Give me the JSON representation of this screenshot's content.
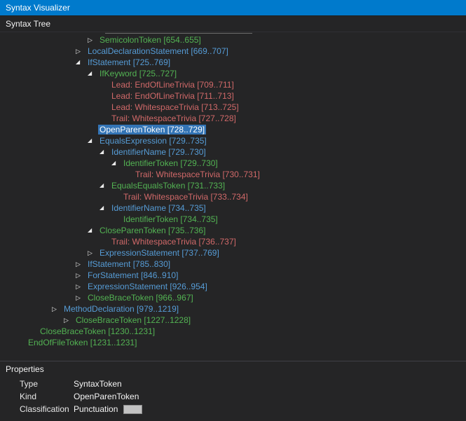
{
  "window": {
    "title": "Syntax Visualizer"
  },
  "panel": {
    "header": "Syntax Tree"
  },
  "colors": {
    "titlebar": "#007ACC",
    "node": "#569CD6",
    "token": "#53B353",
    "trivia": "#D16969",
    "selection_bg": "#3374B5"
  },
  "icons": {
    "expander_collapsed": "▷",
    "expander_expanded": "◢"
  },
  "tree": {
    "rows": [
      {
        "label": "SemicolonToken",
        "range": "[654..655]",
        "kind": "token",
        "level": 7,
        "expander": "collapsed",
        "selected": false
      },
      {
        "label": "LocalDeclarationStatement",
        "range": "[669..707]",
        "kind": "node",
        "level": 6,
        "expander": "collapsed",
        "selected": false
      },
      {
        "label": "IfStatement",
        "range": "[725..769]",
        "kind": "node",
        "level": 6,
        "expander": "expanded",
        "selected": false
      },
      {
        "label": "IfKeyword",
        "range": "[725..727]",
        "kind": "token",
        "level": 7,
        "expander": "expanded",
        "selected": false
      },
      {
        "label": "Lead: EndOfLineTrivia",
        "range": "[709..711]",
        "kind": "trivia",
        "level": 8,
        "expander": "none",
        "selected": false
      },
      {
        "label": "Lead: EndOfLineTrivia",
        "range": "[711..713]",
        "kind": "trivia",
        "level": 8,
        "expander": "none",
        "selected": false
      },
      {
        "label": "Lead: WhitespaceTrivia",
        "range": "[713..725]",
        "kind": "trivia",
        "level": 8,
        "expander": "none",
        "selected": false
      },
      {
        "label": "Trail: WhitespaceTrivia",
        "range": "[727..728]",
        "kind": "trivia",
        "level": 8,
        "expander": "none",
        "selected": false
      },
      {
        "label": "OpenParenToken",
        "range": "[728..729]",
        "kind": "token",
        "level": 7,
        "expander": "none",
        "selected": true
      },
      {
        "label": "EqualsExpression",
        "range": "[729..735]",
        "kind": "node",
        "level": 7,
        "expander": "expanded",
        "selected": false
      },
      {
        "label": "IdentifierName",
        "range": "[729..730]",
        "kind": "node",
        "level": 8,
        "expander": "expanded",
        "selected": false
      },
      {
        "label": "IdentifierToken",
        "range": "[729..730]",
        "kind": "token",
        "level": 9,
        "expander": "expanded",
        "selected": false
      },
      {
        "label": "Trail: WhitespaceTrivia",
        "range": "[730..731]",
        "kind": "trivia",
        "level": 10,
        "expander": "none",
        "selected": false
      },
      {
        "label": "EqualsEqualsToken",
        "range": "[731..733]",
        "kind": "token",
        "level": 8,
        "expander": "expanded",
        "selected": false
      },
      {
        "label": "Trail: WhitespaceTrivia",
        "range": "[733..734]",
        "kind": "trivia",
        "level": 9,
        "expander": "none",
        "selected": false
      },
      {
        "label": "IdentifierName",
        "range": "[734..735]",
        "kind": "node",
        "level": 8,
        "expander": "expanded",
        "selected": false
      },
      {
        "label": "IdentifierToken",
        "range": "[734..735]",
        "kind": "token",
        "level": 9,
        "expander": "none",
        "selected": false
      },
      {
        "label": "CloseParenToken",
        "range": "[735..736]",
        "kind": "token",
        "level": 7,
        "expander": "expanded",
        "selected": false
      },
      {
        "label": "Trail: WhitespaceTrivia",
        "range": "[736..737]",
        "kind": "trivia",
        "level": 8,
        "expander": "none",
        "selected": false
      },
      {
        "label": "ExpressionStatement",
        "range": "[737..769]",
        "kind": "node",
        "level": 7,
        "expander": "collapsed",
        "selected": false
      },
      {
        "label": "IfStatement",
        "range": "[785..830]",
        "kind": "node",
        "level": 6,
        "expander": "collapsed",
        "selected": false
      },
      {
        "label": "ForStatement",
        "range": "[846..910]",
        "kind": "node",
        "level": 6,
        "expander": "collapsed",
        "selected": false
      },
      {
        "label": "ExpressionStatement",
        "range": "[926..954]",
        "kind": "node",
        "level": 6,
        "expander": "collapsed",
        "selected": false
      },
      {
        "label": "CloseBraceToken",
        "range": "[966..967]",
        "kind": "token",
        "level": 6,
        "expander": "collapsed",
        "selected": false
      },
      {
        "label": "MethodDeclaration",
        "range": "[979..1219]",
        "kind": "node",
        "level": 4,
        "expander": "collapsed",
        "selected": false
      },
      {
        "label": "CloseBraceToken",
        "range": "[1227..1228]",
        "kind": "token",
        "level": 5,
        "expander": "collapsed",
        "selected": false
      },
      {
        "label": "CloseBraceToken",
        "range": "[1230..1231]",
        "kind": "token",
        "level": 2,
        "expander": "none",
        "selected": false
      },
      {
        "label": "EndOfFileToken",
        "range": "[1231..1231]",
        "kind": "token",
        "level": 1,
        "expander": "none",
        "selected": false
      }
    ]
  },
  "properties": {
    "header": "Properties",
    "rows": [
      {
        "name": "Type",
        "value": "SyntaxToken",
        "swatch": false
      },
      {
        "name": "Kind",
        "value": "OpenParenToken",
        "swatch": false
      },
      {
        "name": "Classification",
        "value": "Punctuation",
        "swatch": true
      }
    ]
  }
}
